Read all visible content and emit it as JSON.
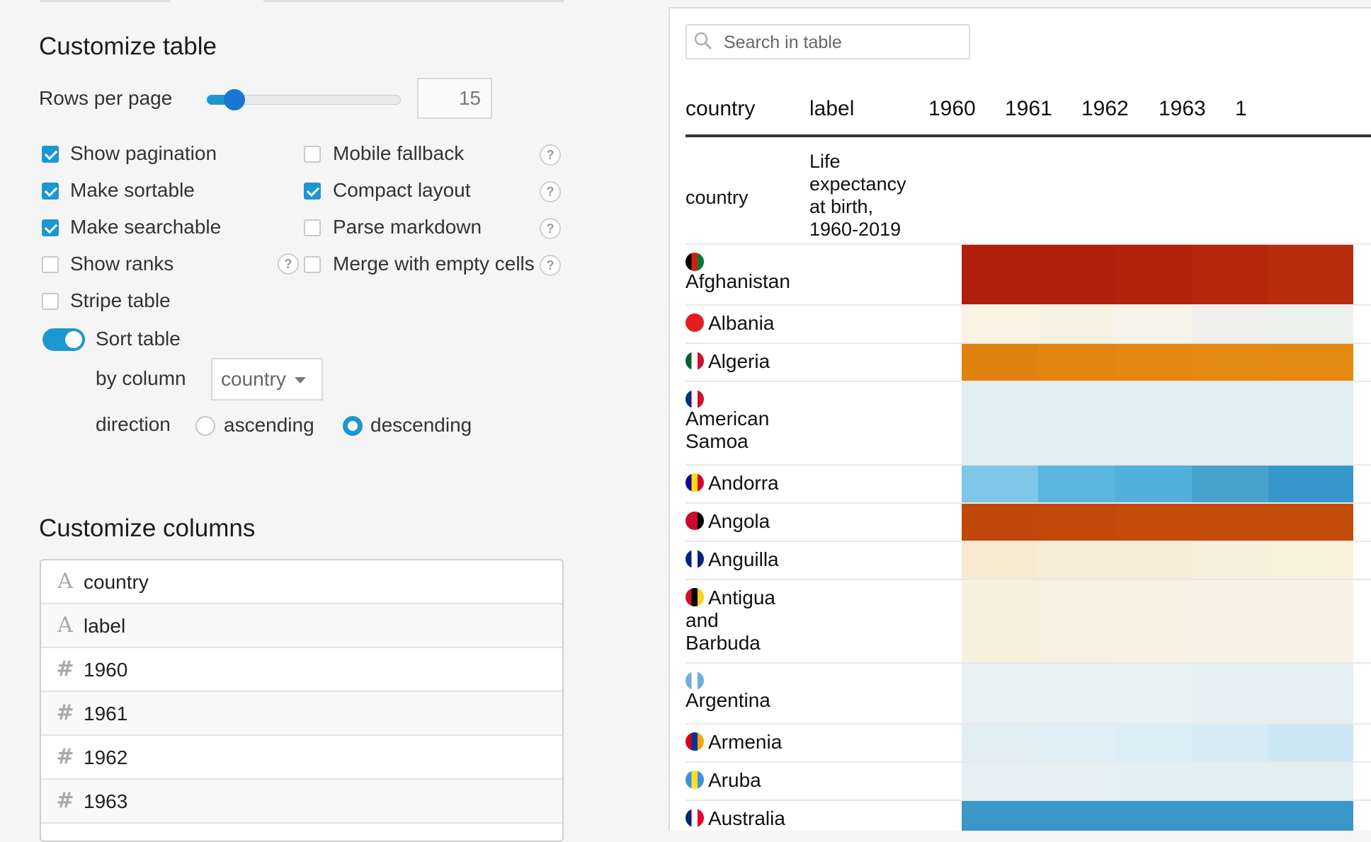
{
  "customize_table": {
    "title": "Customize table",
    "rows_per_page_label": "Rows per page",
    "rows_per_page_value": "15",
    "rows_per_page_slider_fraction": 0.15,
    "options": [
      {
        "label": "Show pagination",
        "checked": true
      },
      {
        "label": "Make sortable",
        "checked": true
      },
      {
        "label": "Make searchable",
        "checked": true
      },
      {
        "label": "Show ranks",
        "checked": false
      },
      {
        "label": "Stripe table",
        "checked": false
      }
    ],
    "options_right": [
      {
        "label": "Mobile fallback",
        "checked": false
      },
      {
        "label": "Compact layout",
        "checked": true
      },
      {
        "label": "Parse markdown",
        "checked": false
      },
      {
        "label": "Merge with empty cells",
        "checked": false
      }
    ],
    "help_glyph": "?",
    "sort_table_label": "Sort table",
    "sort_table_on": true,
    "by_column_label": "by column",
    "by_column_value": "country",
    "direction_label": "direction",
    "direction_options": [
      "ascending",
      "descending"
    ],
    "direction_selected": "descending"
  },
  "customize_columns": {
    "title": "Customize columns",
    "columns": [
      {
        "name": "country",
        "type_icon": "text-type-icon",
        "glyph": "A"
      },
      {
        "name": "label",
        "type_icon": "text-type-icon",
        "glyph": "A"
      },
      {
        "name": "1960",
        "type_icon": "number-type-icon",
        "glyph": "#"
      },
      {
        "name": "1961",
        "type_icon": "number-type-icon",
        "glyph": "#"
      },
      {
        "name": "1962",
        "type_icon": "number-type-icon",
        "glyph": "#"
      },
      {
        "name": "1963",
        "type_icon": "number-type-icon",
        "glyph": "#"
      }
    ]
  },
  "table_preview": {
    "search_placeholder": "Search in table",
    "headers": [
      "country",
      "label",
      "1960",
      "1961",
      "1962",
      "1963",
      "1"
    ],
    "subheader": {
      "country": "country",
      "label": "Life expectancy at birth, 1960-2019"
    },
    "rows": [
      {
        "country": "Afghanistan",
        "flag_colors": [
          "#000000",
          "#d32011",
          "#007a36"
        ],
        "cells": [
          "#b01f0c",
          "#b0200b",
          "#b3230b",
          "#b5260b",
          "#b82d0b"
        ]
      },
      {
        "country": "Albania",
        "flag_colors": [
          "#e41e20",
          "#e41e20",
          "#e41e20"
        ],
        "cells": [
          "#faf2e2",
          "#f7f3e4",
          "#f6f3ea",
          "#efefec",
          "#edf2ef"
        ]
      },
      {
        "country": "Algeria",
        "flag_colors": [
          "#006233",
          "#ffffff",
          "#d21034"
        ],
        "cells": [
          "#e0820e",
          "#e2850e",
          "#e38710",
          "#e48a12",
          "#e38810"
        ]
      },
      {
        "country": "American Samoa",
        "flag_colors": [
          "#002b7f",
          "#ffffff",
          "#ce1126"
        ],
        "cells": [
          "#e1eff1",
          "#e1eff1",
          "#e1eff1",
          "#e1eff1",
          "#e1eff1"
        ]
      },
      {
        "country": "Andorra",
        "flag_colors": [
          "#10069f",
          "#fedd00",
          "#d50032"
        ],
        "cells": [
          "#7fc6e8",
          "#5ab6e0",
          "#51b0dc",
          "#48a2ce",
          "#3797cb"
        ]
      },
      {
        "country": "Angola",
        "flag_colors": [
          "#cc092f",
          "#cc092f",
          "#000000"
        ],
        "cells": [
          "#c04808",
          "#c14a08",
          "#c24c08",
          "#c24c08",
          "#c24c08"
        ]
      },
      {
        "country": "Anguilla",
        "flag_colors": [
          "#00247d",
          "#ffffff",
          "#00247d"
        ],
        "cells": [
          "#f8ead0",
          "#f7ecd5",
          "#f7edd7",
          "#f8f0dc",
          "#f9f1dc"
        ]
      },
      {
        "country": "Antigua and Barbuda",
        "flag_colors": [
          "#ce1126",
          "#000000",
          "#fcd116"
        ],
        "cells": [
          "#f8f0df",
          "#f8f1e3",
          "#f8f1e4",
          "#f8f2e6",
          "#f8f2e6"
        ]
      },
      {
        "country": "Argentina",
        "flag_colors": [
          "#74acdf",
          "#ffffff",
          "#74acdf"
        ],
        "cells": [
          "#e7f1f2",
          "#e7f1f2",
          "#e8f1f2",
          "#e6f0f2",
          "#e6f0f2"
        ]
      },
      {
        "country": "Armenia",
        "flag_colors": [
          "#d90012",
          "#0033a0",
          "#f2a800"
        ],
        "cells": [
          "#e1eff2",
          "#def0f5",
          "#dbeef6",
          "#d6ebf6",
          "#cce6f4"
        ]
      },
      {
        "country": "Aruba",
        "flag_colors": [
          "#418fde",
          "#fbe122",
          "#418fde"
        ],
        "cells": [
          "#e4f0f2",
          "#e4f0f3",
          "#e2eff3",
          "#e1eff3",
          "#e1eff3"
        ]
      },
      {
        "country": "Australia",
        "flag_colors": [
          "#012169",
          "#ffffff",
          "#e4002b"
        ],
        "cells": [
          "#3a97c8",
          "#3a97c8",
          "#3a97c8",
          "#3a97c8",
          "#3a97c8"
        ]
      }
    ]
  }
}
